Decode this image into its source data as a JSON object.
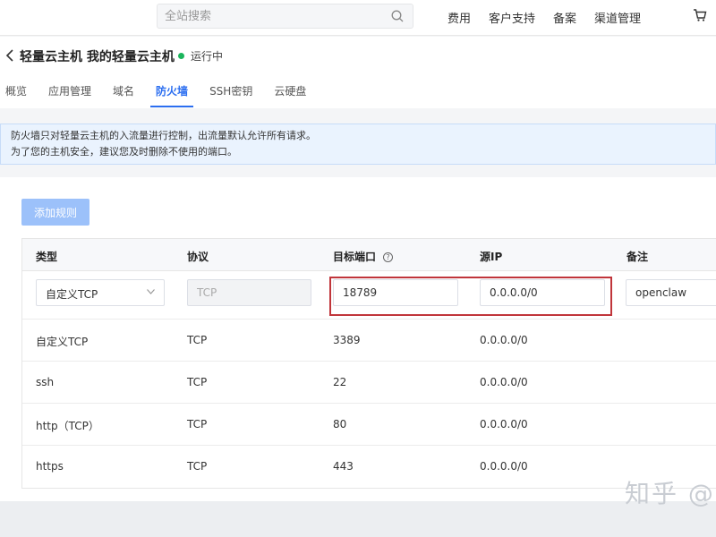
{
  "topnav": {
    "search_placeholder": "全站搜索",
    "links": [
      "费用",
      "客户支持",
      "备案",
      "渠道管理"
    ]
  },
  "header": {
    "title": "轻量云主机 我的轻量云主机",
    "status": "运行中",
    "status_color": "#1bb55c",
    "tabs": [
      "概览",
      "应用管理",
      "域名",
      "防火墙",
      "SSH密钥",
      "云硬盘"
    ],
    "active_tab": "防火墙"
  },
  "notice": {
    "line1": "防火墙只对轻量云主机的入流量进行控制，出流量默认允许所有请求。",
    "line2": "为了您的主机安全，建议您及时删除不使用的端口。"
  },
  "toolbar": {
    "add_rule_label": "添加规则"
  },
  "table": {
    "headers": {
      "type": "类型",
      "protocol": "协议",
      "port": "目标端口",
      "source_ip": "源IP",
      "note": "备注"
    },
    "edit_row": {
      "type": "自定义TCP",
      "protocol": "TCP",
      "port": "18789",
      "source_ip": "0.0.0.0/0",
      "note": "openclaw"
    },
    "rows": [
      {
        "type": "自定义TCP",
        "protocol": "TCP",
        "port": "3389",
        "source_ip": "0.0.0.0/0"
      },
      {
        "type": "ssh",
        "protocol": "TCP",
        "port": "22",
        "source_ip": "0.0.0.0/0"
      },
      {
        "type": "http（TCP）",
        "protocol": "TCP",
        "port": "80",
        "source_ip": "0.0.0.0/0"
      },
      {
        "type": "https",
        "protocol": "TCP",
        "port": "443",
        "source_ip": "0.0.0.0/0"
      }
    ]
  },
  "watermark": "知乎 @",
  "colors": {
    "accent": "#2b6ef0",
    "highlight_border": "#c0353a",
    "notice_bg": "#eaf3fe"
  }
}
